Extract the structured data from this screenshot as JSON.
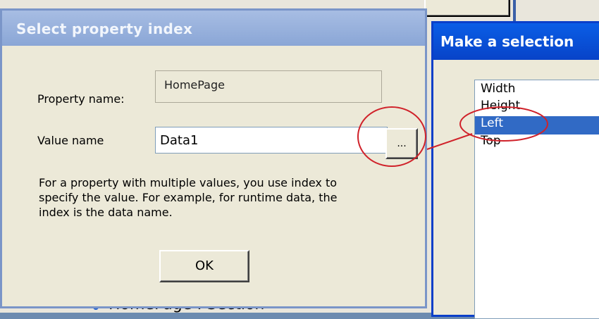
{
  "background": {
    "tree_item_label": "HomePage : Section"
  },
  "dialog_property_index": {
    "title": "Select property index",
    "property_name_label": "Property name:",
    "property_name_value": "HomePage",
    "value_name_label": "Value name",
    "value_name_input": "Data1",
    "browse_label": "...",
    "description": "For a property with multiple values, you use index to specify the value. For example, for runtime data, the index is the data name.",
    "ok_label": "OK"
  },
  "dialog_selection": {
    "title": "Make a selection",
    "items": [
      "Width",
      "Height",
      "Left",
      "Top"
    ],
    "selected": "Left"
  },
  "annotation": {
    "color": "#d0222a"
  },
  "colors": {
    "selection": "#316ac5",
    "active_titlebar": "#0a5ee6",
    "inactive_titlebar": "#8aa6d6"
  }
}
